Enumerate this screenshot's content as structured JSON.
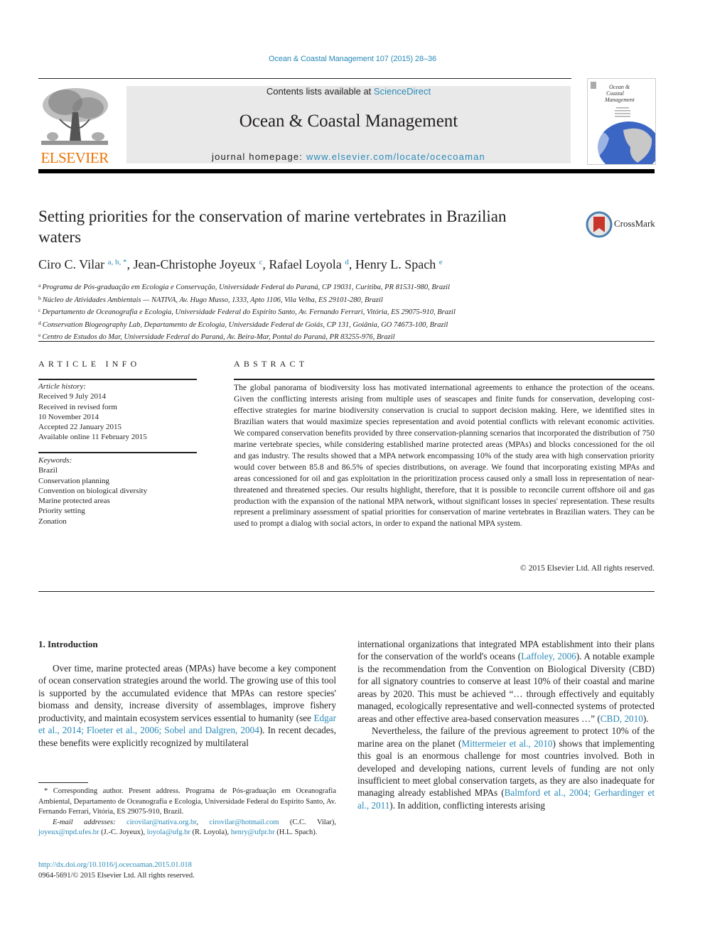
{
  "header": {
    "journal_ref": "Ocean & Coastal Management 107 (2015) 28–36",
    "contents_prefix": "Contents lists available at ",
    "contents_link": "ScienceDirect",
    "journal_title": "Ocean & Coastal Management",
    "homepage_prefix": "journal homepage: ",
    "homepage_link": "www.elsevier.com/locate/ocecoaman",
    "publisher_logo_text": "ELSEVIER",
    "cover_title_lines": [
      "Ocean &",
      "Coastal",
      "Management"
    ],
    "colors": {
      "link": "#2a8ab8",
      "elsevier_orange": "#ee7203",
      "header_gray": "#e9e9e9"
    }
  },
  "article": {
    "title": "Setting priorities for the conservation of marine vertebrates in Brazilian waters",
    "crossmark_label": "CrossMark",
    "authors": [
      {
        "name": "Ciro C. Vilar",
        "marks": "a, b, *"
      },
      {
        "name": "Jean-Christophe Joyeux",
        "marks": "c"
      },
      {
        "name": "Rafael Loyola",
        "marks": "d"
      },
      {
        "name": "Henry L. Spach",
        "marks": "e"
      }
    ],
    "affiliations": [
      {
        "mark": "a",
        "text": "Programa de Pós-graduação em Ecologia e Conservação, Universidade Federal do Paraná, CP 19031, Curitiba, PR 81531-980, Brazil"
      },
      {
        "mark": "b",
        "text": "Núcleo de Atividades Ambientais — NATIVA, Av. Hugo Musso, 1333, Apto 1106, Vila Velha, ES 29101-280, Brazil"
      },
      {
        "mark": "c",
        "text": "Departamento de Oceanografia e Ecologia, Universidade Federal do Espírito Santo, Av. Fernando Ferrari, Vitória, ES 29075-910, Brazil"
      },
      {
        "mark": "d",
        "text": "Conservation Biogeography Lab, Departamento de Ecologia, Universidade Federal de Goiás, CP 131, Goiânia, GO 74673-100, Brazil"
      },
      {
        "mark": "e",
        "text": "Centro de Estudos do Mar, Universidade Federal do Paraná, Av. Beira-Mar, Pontal do Paraná, PR 83255-976, Brazil"
      }
    ]
  },
  "article_info": {
    "heading": "ARTICLE INFO",
    "history_label": "Article history:",
    "history": [
      "Received 9 July 2014",
      "Received in revised form",
      "10 November 2014",
      "Accepted 22 January 2015",
      "Available online 11 February 2015"
    ],
    "keywords_label": "Keywords:",
    "keywords": [
      "Brazil",
      "Conservation planning",
      "Convention on biological diversity",
      "Marine protected areas",
      "Priority setting",
      "Zonation"
    ]
  },
  "abstract": {
    "heading": "ABSTRACT",
    "text": "The global panorama of biodiversity loss has motivated international agreements to enhance the pro­tection of the oceans. Given the conflicting interests arising from multiple uses of seascapes and finite funds for conservation, developing cost-effective strategies for marine biodiversity conservation is crucial to support decision making. Here, we identified sites in Brazilian waters that would maximize species representation and avoid potential conflicts with relevant economic activities. We compared conserva­tion benefits provided by three conservation-planning scenarios that incorporated the distribution of 750 marine vertebrate species, while considering established marine protected areas (MPAs) and blocks concessioned for the oil and gas industry. The results showed that a MPA network encompassing 10% of the study area with high conservation priority would cover between 85.8 and 86.5% of species distri­butions, on average. We found that incorporating existing MPAs and areas concessioned for oil and gas exploitation in the prioritization process caused only a small loss in representation of near-threatened and threatened species. Our results highlight, therefore, that it is possible to reconcile current offshore oil and gas production with the expansion of the national MPA network, without significant losses in species' representation. These results represent a preliminary assessment of spatial priorities for con­servation of marine vertebrates in Brazilian waters. They can be used to prompt a dialog with social actors, in order to expand the national MPA system.",
    "copyright": "© 2015 Elsevier Ltd. All rights reserved."
  },
  "introduction": {
    "heading": "1.  Introduction",
    "left_p1_a": "Over time, marine protected areas (MPAs) have become a key component of ocean conservation strategies around the world. The growing use of this tool is supported by the accumulated evidence that MPAs can restore species' biomass and density, increase di­versity of assemblages, improve fishery productivity, and maintain ecosystem services essential to humanity (see ",
    "left_p1_cite": "Edgar et al., 2014; Floeter et al., 2006; Sobel and Dalgren, 2004",
    "left_p1_b": "). In recent decades, these benefits were explicitly recognized by multilateral",
    "right_p1_a": "international organizations that integrated MPA establishment into their plans for the conservation of the world's oceans (",
    "right_p1_cite1": "Laffoley, 2006",
    "right_p1_b": "). A notable example is the recommendation from the Convention on Biological Diversity (CBD) for all signatory countries to conserve at least 10% of their coastal and marine areas by 2020. This must be achieved “… through effectively and equitably managed, ecologically representative and well-connected systems of protected areas and other effective area-based conservation measures …” (",
    "right_p1_cite2": "CBD, 2010",
    "right_p1_c": ").",
    "right_p2_a": "Nevertheless, the failure of the previous agreement to protect 10% of the marine area on the planet (",
    "right_p2_cite1": "Mittermeier et al., 2010",
    "right_p2_b": ") shows that implementing this goal is an enormous challenge for most countries involved. Both in developed and developing na­tions, current levels of funding are not only insufficient to meet global conservation targets, as they are also inadequate for man­aging already established MPAs (",
    "right_p2_cite2": "Balmford et al., 2004; Gerhardinger et al., 2011",
    "right_p2_c": "). In addition, conflicting interests arising"
  },
  "footnotes": {
    "corresponding": "* Corresponding author. Present address. Programa de Pós-graduação em Oce­anografia Ambiental, Departamento de Oceanografia e Ecologia, Universidade Federal do Espírito Santo, Av. Fernando Ferrari, Vitória, ES 29075-910, Brazil.",
    "email_label": "E-mail addresses:",
    "emails": [
      {
        "address": "cirovilar@nativa.org.br",
        "after": ", "
      },
      {
        "address": "cirovilar@hotmail.com",
        "after": " (C.C. Vilar), "
      },
      {
        "address": "joyeux@npd.ufes.br",
        "after": " (J.-C. Joyeux), "
      },
      {
        "address": "loyola@ufg.br",
        "after": " (R. Loyola), "
      },
      {
        "address": "henry@ufpr.br",
        "after": " (H.L. Spach)."
      }
    ],
    "doi": "http://dx.doi.org/10.1016/j.ocecoaman.2015.01.018",
    "issn_line": "0964-5691/© 2015 Elsevier Ltd. All rights reserved."
  }
}
